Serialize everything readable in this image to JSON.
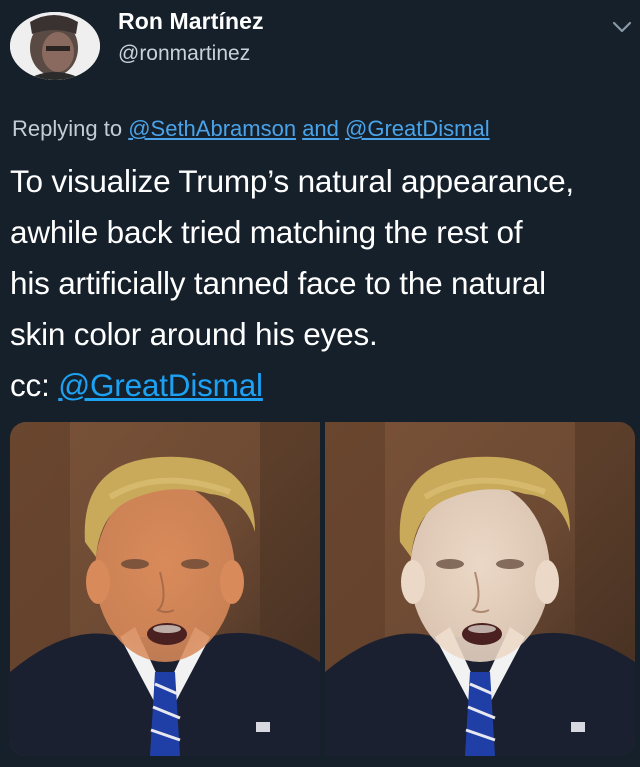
{
  "author": {
    "display_name": "Ron Martínez",
    "handle": "@ronmartinez",
    "avatar_icon": "profile-photo"
  },
  "menu": {
    "icon": "chevron-down-icon"
  },
  "reply": {
    "prefix": "Replying to",
    "mention_1": "@SethAbramson",
    "joiner": "and",
    "mention_2": "@GreatDismal"
  },
  "tweet": {
    "lines": [
      "To visualize Trump’s natural appearance,",
      "awhile back tried matching the rest of",
      "his artificially tanned face to the natural",
      "skin color around his eyes."
    ],
    "cc_prefix": "cc:",
    "cc_mention": "@GreatDismal"
  },
  "media": {
    "photos": [
      {
        "name": "original-tan-photo",
        "skin_color": "#d98a5a"
      },
      {
        "name": "natural-color-photo",
        "skin_color": "#ecd8c6"
      }
    ],
    "colors": {
      "hair": "#c9a95a",
      "suit": "#1b2030",
      "shirt": "#f2f2f2",
      "tie": "#1f3fa6",
      "background": "#6d4a33"
    }
  },
  "colors": {
    "background": "#15202b",
    "link": "#1da1f2",
    "text": "#ffffff",
    "secondary_text": "#c4ccd4"
  }
}
